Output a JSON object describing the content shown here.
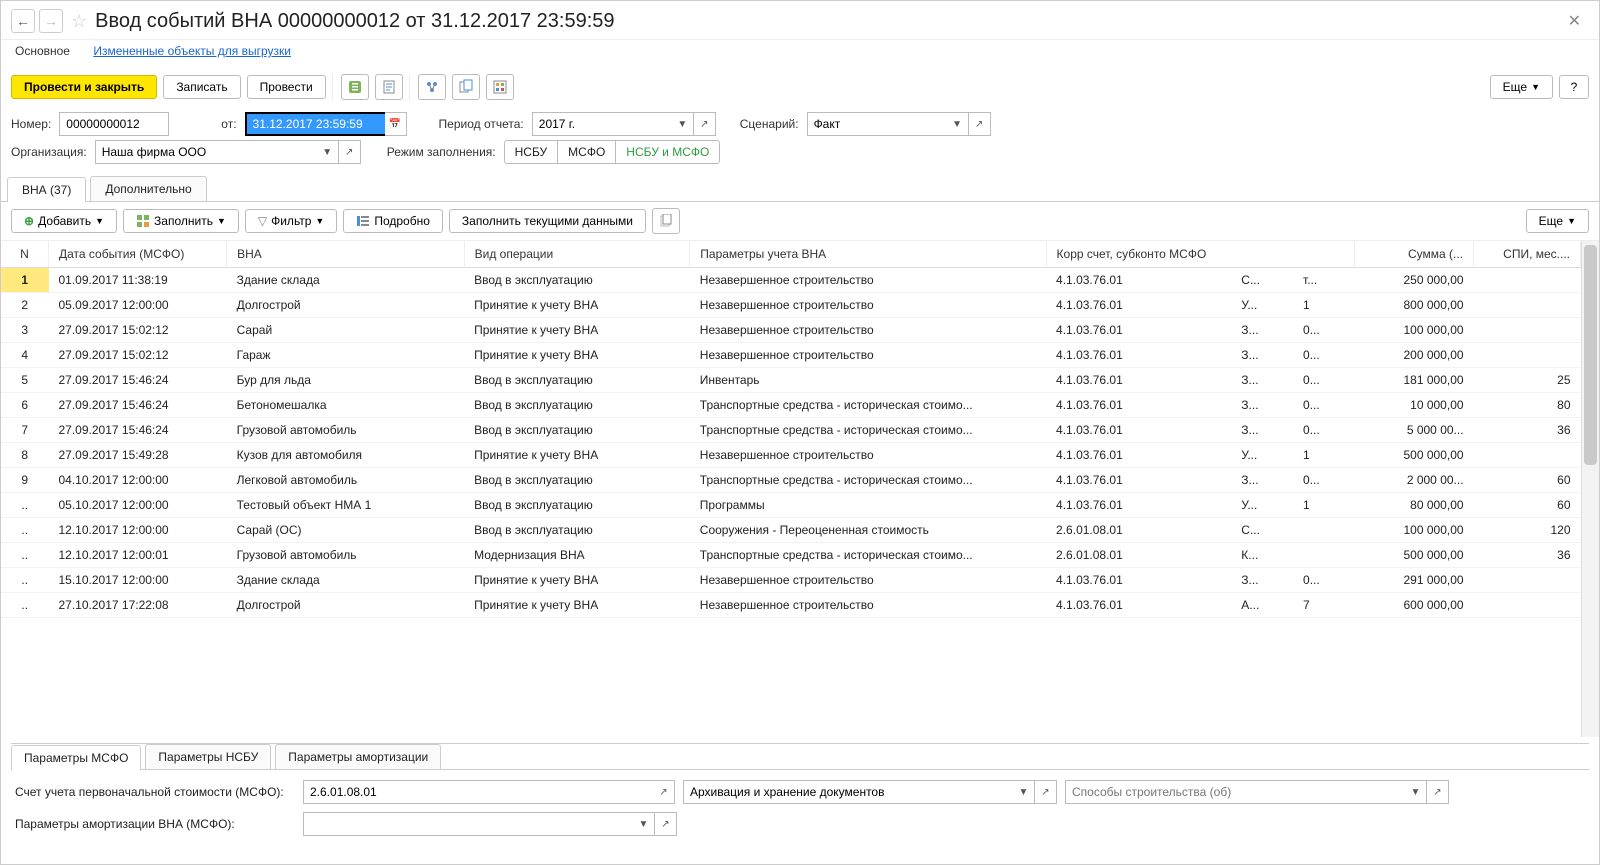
{
  "header": {
    "title": "Ввод событий ВНА 00000000012 от 31.12.2017 23:59:59"
  },
  "link_row": {
    "main": "Основное",
    "changed": "Измененные объекты для выгрузки"
  },
  "toolbar": {
    "post_close": "Провести и закрыть",
    "save": "Записать",
    "post": "Провести",
    "more": "Еще",
    "help": "?"
  },
  "form": {
    "number_label": "Номер:",
    "number": "00000000012",
    "from_label": "от:",
    "from": "31.12.2017 23:59:59",
    "period_label": "Период отчета:",
    "period": "2017 г.",
    "scenario_label": "Сценарий:",
    "scenario": "Факт",
    "org_label": "Организация:",
    "org": "Наша фирма ООО",
    "mode_label": "Режим заполнения:",
    "mode_nsbu": "НСБУ",
    "mode_msfo": "МСФО",
    "mode_both": "НСБУ и МСФО"
  },
  "main_tabs": {
    "tab1": "ВНА (37)",
    "tab2": "Дополнительно"
  },
  "sub_toolbar": {
    "add": "Добавить",
    "fill": "Заполнить",
    "filter": "Фильтр",
    "detail": "Подробно",
    "fill_current": "Заполнить текущими данными",
    "more": "Еще"
  },
  "columns": {
    "n": "N",
    "date": "Дата события (МСФО)",
    "vna": "ВНА",
    "op": "Вид операции",
    "params": "Параметры учета ВНА",
    "corr": "Корр счет, субконто МСФО",
    "sum": "Сумма (...",
    "spi": "СПИ, мес...."
  },
  "rows": [
    {
      "n": "1",
      "date": "01.09.2017 11:38:19",
      "vna": "Здание склада",
      "op": "Ввод в эксплуатацию",
      "params": "Незавершенное строительство",
      "c1": "4.1.03.76.01",
      "c2": "С...",
      "c3": "т...",
      "sum": "250 000,00",
      "spi": ""
    },
    {
      "n": "2",
      "date": "05.09.2017 12:00:00",
      "vna": "Долгострой",
      "op": "Принятие к учету ВНА",
      "params": "Незавершенное строительство",
      "c1": "4.1.03.76.01",
      "c2": "У...",
      "c3": "1",
      "sum": "800 000,00",
      "spi": ""
    },
    {
      "n": "3",
      "date": "27.09.2017 15:02:12",
      "vna": "Сарай",
      "op": "Принятие к учету ВНА",
      "params": "Незавершенное строительство",
      "c1": "4.1.03.76.01",
      "c2": "З...",
      "c3": "0...",
      "sum": "100 000,00",
      "spi": ""
    },
    {
      "n": "4",
      "date": "27.09.2017 15:02:12",
      "vna": "Гараж",
      "op": "Принятие к учету ВНА",
      "params": "Незавершенное строительство",
      "c1": "4.1.03.76.01",
      "c2": "З...",
      "c3": "0...",
      "sum": "200 000,00",
      "spi": ""
    },
    {
      "n": "5",
      "date": "27.09.2017 15:46:24",
      "vna": "Бур для льда",
      "op": "Ввод в эксплуатацию",
      "params": "Инвентарь",
      "c1": "4.1.03.76.01",
      "c2": "З...",
      "c3": "0...",
      "sum": "181 000,00",
      "spi": "25"
    },
    {
      "n": "6",
      "date": "27.09.2017 15:46:24",
      "vna": "Бетономешалка",
      "op": "Ввод в эксплуатацию",
      "params": "Транспортные средства - историческая стоимо...",
      "c1": "4.1.03.76.01",
      "c2": "З...",
      "c3": "0...",
      "sum": "10 000,00",
      "spi": "80"
    },
    {
      "n": "7",
      "date": "27.09.2017 15:46:24",
      "vna": "Грузовой автомобиль",
      "op": "Ввод в эксплуатацию",
      "params": "Транспортные средства - историческая стоимо...",
      "c1": "4.1.03.76.01",
      "c2": "З...",
      "c3": "0...",
      "sum": "5 000 00...",
      "spi": "36"
    },
    {
      "n": "8",
      "date": "27.09.2017 15:49:28",
      "vna": "Кузов для автомобиля",
      "op": "Принятие к учету ВНА",
      "params": "Незавершенное строительство",
      "c1": "4.1.03.76.01",
      "c2": "У...",
      "c3": "1",
      "sum": "500 000,00",
      "spi": ""
    },
    {
      "n": "9",
      "date": "04.10.2017 12:00:00",
      "vna": "Легковой автомобиль",
      "op": "Ввод в эксплуатацию",
      "params": "Транспортные средства - историческая стоимо...",
      "c1": "4.1.03.76.01",
      "c2": "З...",
      "c3": "0...",
      "sum": "2 000 00...",
      "spi": "60"
    },
    {
      "n": "..",
      "date": "05.10.2017 12:00:00",
      "vna": "Тестовый объект НМА 1",
      "op": "Ввод в эксплуатацию",
      "params": "Программы",
      "c1": "4.1.03.76.01",
      "c2": "У...",
      "c3": "1",
      "sum": "80 000,00",
      "spi": "60"
    },
    {
      "n": "..",
      "date": "12.10.2017 12:00:00",
      "vna": "Сарай (ОС)",
      "op": "Ввод в эксплуатацию",
      "params": "Сооружения - Переоцененная стоимость",
      "c1": "2.6.01.08.01",
      "c2": "С...",
      "c3": "",
      "sum": "100 000,00",
      "spi": "120"
    },
    {
      "n": "..",
      "date": "12.10.2017 12:00:01",
      "vna": "Грузовой автомобиль",
      "op": "Модернизация ВНА",
      "params": "Транспортные средства - историческая стоимо...",
      "c1": "2.6.01.08.01",
      "c2": "К...",
      "c3": "",
      "sum": "500 000,00",
      "spi": "36"
    },
    {
      "n": "..",
      "date": "15.10.2017 12:00:00",
      "vna": "Здание склада",
      "op": "Принятие к учету ВНА",
      "params": "Незавершенное строительство",
      "c1": "4.1.03.76.01",
      "c2": "З...",
      "c3": "0...",
      "sum": "291 000,00",
      "spi": ""
    },
    {
      "n": "..",
      "date": "27.10.2017 17:22:08",
      "vna": "Долгострой",
      "op": "Принятие к учету ВНА",
      "params": "Незавершенное строительство",
      "c1": "4.1.03.76.01",
      "c2": "А...",
      "c3": "7",
      "sum": "600 000,00",
      "spi": ""
    }
  ],
  "bottom_tabs": {
    "t1": "Параметры МСФО",
    "t2": "Параметры НСБУ",
    "t3": "Параметры амортизации"
  },
  "bottom_form": {
    "account_label": "Счет учета первоначальной стоимости (МСФО):",
    "account": "2.6.01.08.01",
    "subconto": "Архивация и хранение документов",
    "subconto2_placeholder": "Способы строительства (об)",
    "amort_label": "Параметры амортизации ВНА (МСФО):",
    "amort": ""
  }
}
